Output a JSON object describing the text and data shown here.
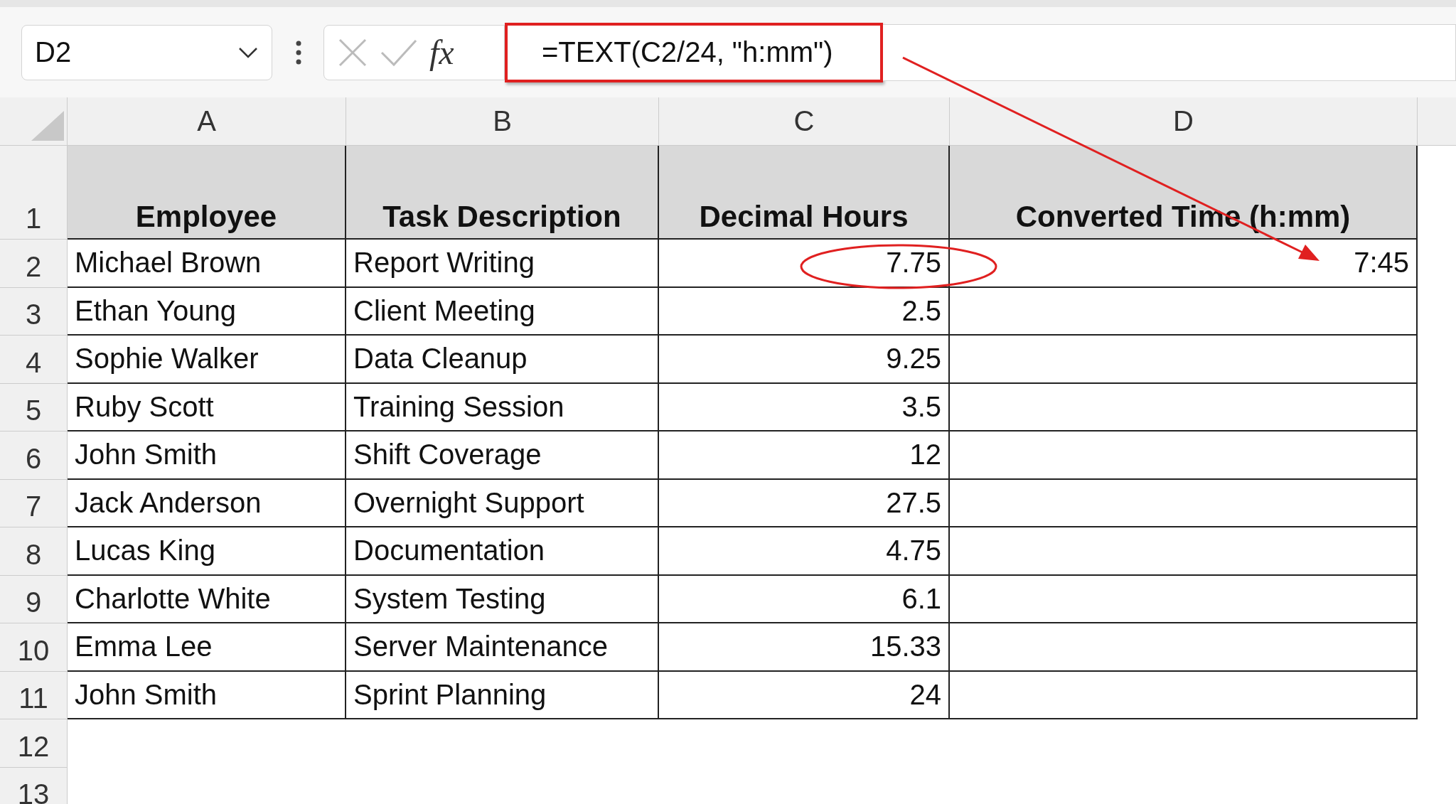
{
  "formula_bar": {
    "name_box": "D2",
    "fx_label": "fx",
    "formula": "=TEXT(C2/24, \"h:mm\")"
  },
  "column_headers": [
    "A",
    "B",
    "C",
    "D"
  ],
  "header_row": {
    "number": "1",
    "cells": [
      "Employee",
      "Task Description",
      "Decimal Hours",
      "Converted Time (h:mm)"
    ]
  },
  "rows": [
    {
      "number": "2",
      "employee": "Michael Brown",
      "task": "Report Writing",
      "hours": "7.75",
      "converted": "7:45"
    },
    {
      "number": "3",
      "employee": "Ethan Young",
      "task": "Client Meeting",
      "hours": "2.5"
    },
    {
      "number": "4",
      "employee": "Sophie Walker",
      "task": "Data Cleanup",
      "hours": "9.25"
    },
    {
      "number": "5",
      "employee": "Ruby Scott",
      "task": "Training Session",
      "hours": "3.5"
    },
    {
      "number": "6",
      "employee": "John Smith",
      "task": "Shift Coverage",
      "hours": "12"
    },
    {
      "number": "7",
      "employee": "Jack Anderson",
      "task": "Overnight Support",
      "hours": "27.5"
    },
    {
      "number": "8",
      "employee": "Lucas King",
      "task": "Documentation",
      "hours": "4.75"
    },
    {
      "number": "9",
      "employee": "Charlotte White",
      "task": "System Testing",
      "hours": "6.1"
    },
    {
      "number": "10",
      "employee": "Emma Lee",
      "task": "Server Maintenance",
      "hours": "15.33"
    },
    {
      "number": "11",
      "employee": "John Smith",
      "task": "Sprint Planning",
      "hours": "24"
    }
  ],
  "empty_rows": [
    {
      "number": "12"
    },
    {
      "number": "13"
    }
  ]
}
